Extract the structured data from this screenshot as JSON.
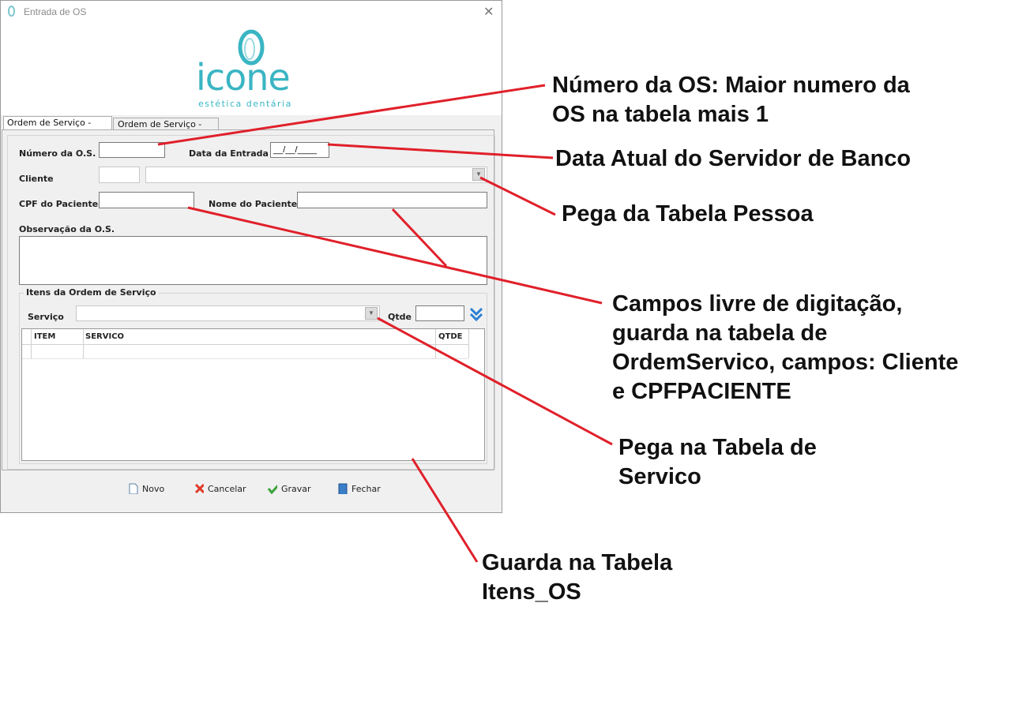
{
  "window": {
    "title": "Entrada de OS",
    "close_glyph": "✕"
  },
  "logo": {
    "name": "icone",
    "tagline": "estética dentária",
    "color": "#3ab5c3"
  },
  "tabs": [
    {
      "label": "Ordem de Serviço - Normal",
      "active": true
    },
    {
      "label": "Ordem de Serviço - Ajuste",
      "active": false
    }
  ],
  "form": {
    "numero_label": "Número da O.S.",
    "numero_value": "",
    "data_label": "Data da Entrada",
    "data_value": "__/__/____",
    "cliente_label": "Cliente",
    "cpf_label": "CPF do Paciente",
    "nome_label": "Nome do Paciente",
    "obs_label": "Observação da O.S."
  },
  "itens": {
    "group_label": "Itens da Ordem de Serviço",
    "servico_label": "Serviço",
    "qtde_label": "Qtde",
    "columns": [
      "ITEM",
      "SERVICO",
      "QTDE"
    ]
  },
  "buttons": {
    "novo": "Novo",
    "cancelar": "Cancelar",
    "gravar": "Gravar",
    "fechar": "Fechar"
  },
  "annotations": {
    "a1": [
      "Número da OS: Maior numero da",
      "OS na tabela mais 1"
    ],
    "a2": [
      "Data Atual do Servidor de Banco"
    ],
    "a3": [
      "Pega da Tabela Pessoa"
    ],
    "a4": [
      "Campos livre de digitação,",
      "guarda na tabela de",
      "OrdemServico, campos: Cliente",
      "e CPFPACIENTE"
    ],
    "a5": [
      "Pega na Tabela de",
      "Servico"
    ],
    "a6": [
      "Guarda na Tabela",
      "Itens_OS"
    ],
    "line_color": "#e0202a"
  }
}
